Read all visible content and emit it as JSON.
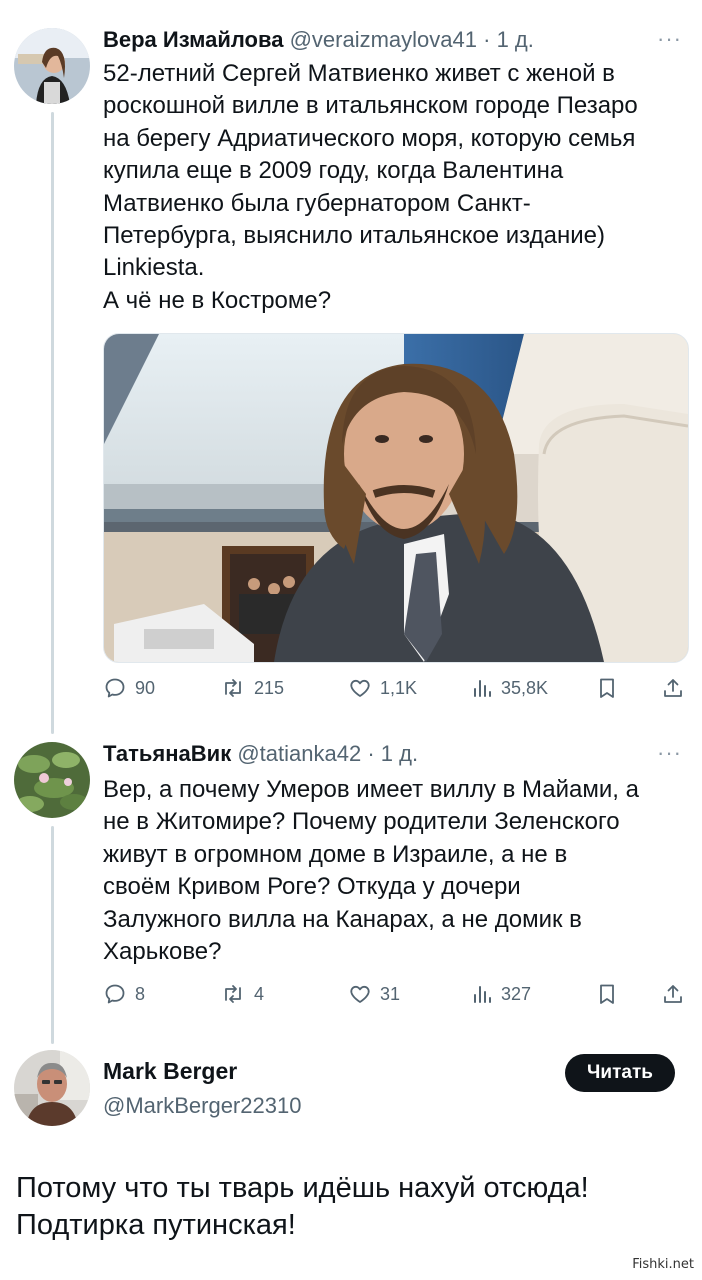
{
  "tweet1": {
    "name": "Вера Измайлова",
    "handle": "@veraizmaylova41",
    "time": "1 д.",
    "text": [
      "52-летний Сергей Матвиенко живет с женой в",
      "роскошной вилле в итальянском городе Пезаро",
      "на берегу Адриатического моря, которую семья",
      "купила еще в 2009 году, когда Валентина",
      "Матвиенко была губернатором Санкт-",
      "Петербурга, выяснило итальянское издание)",
      "Linkiesta.",
      "А чё не в Костроме?"
    ],
    "stats": {
      "replies": "90",
      "retweets": "215",
      "likes": "1,1K",
      "views": "35,8K"
    }
  },
  "tweet2": {
    "name": "ТатьянаВик",
    "handle": "@tatianka42",
    "time": "1 д.",
    "text": [
      "Вер, а почему Умеров имеет виллу в Майами, а",
      "не в Житомире? Почему родители Зеленского",
      "живут в огромном доме в Израиле, а не в",
      "своём Кривом Роге? Откуда у дочери",
      "Залужного вилла на Канарах, а не домик в",
      "Харькове?"
    ],
    "stats": {
      "replies": "8",
      "retweets": "4",
      "likes": "31",
      "views": "327"
    }
  },
  "reply": {
    "name": "Mark Berger",
    "handle": "@MarkBerger22310",
    "follow_label": "Читать",
    "text": [
      "Потому что ты  тварь идёшь нахуй отсюда!",
      "Подтирка путинская!"
    ]
  },
  "separator": "·",
  "more_glyph": "···",
  "watermark": "Fishki.net",
  "icons": [
    "reply-icon",
    "retweet-icon",
    "like-icon",
    "views-icon",
    "bookmark-icon",
    "share-icon",
    "more-icon"
  ],
  "colors": {
    "text": "#0f1419",
    "secondary": "#536471",
    "thread_line": "#cfd9de",
    "button": "#0f1419"
  }
}
